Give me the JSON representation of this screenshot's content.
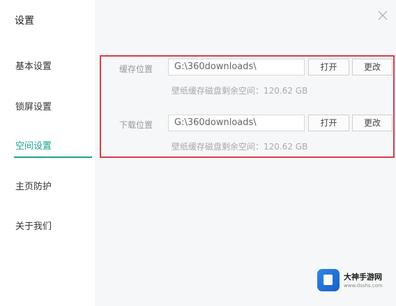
{
  "window": {
    "title": "设置",
    "accent_color": "#17a38c",
    "highlight_color": "#d93d4a"
  },
  "sidebar": {
    "items": [
      {
        "label": "基本设置",
        "active": false
      },
      {
        "label": "锁屏设置",
        "active": false
      },
      {
        "label": "空间设置",
        "active": true
      },
      {
        "label": "主页防护",
        "active": false
      },
      {
        "label": "关于我们",
        "active": false
      }
    ]
  },
  "close_icon": "close-icon",
  "storage": {
    "cache": {
      "label": "缓存位置",
      "path": "G:\\360downloads\\",
      "open_label": "打开",
      "change_label": "更改",
      "free_space": "壁纸缓存磁盘剩余空间：120.62 GB"
    },
    "download": {
      "label": "下载位置",
      "path": "G:\\360downloads\\",
      "open_label": "打开",
      "change_label": "更改",
      "free_space": "壁纸缓存磁盘剩余空间：120.62 GB"
    }
  },
  "watermark": {
    "name": "大神手游网",
    "url": "www.dsshs.com"
  }
}
